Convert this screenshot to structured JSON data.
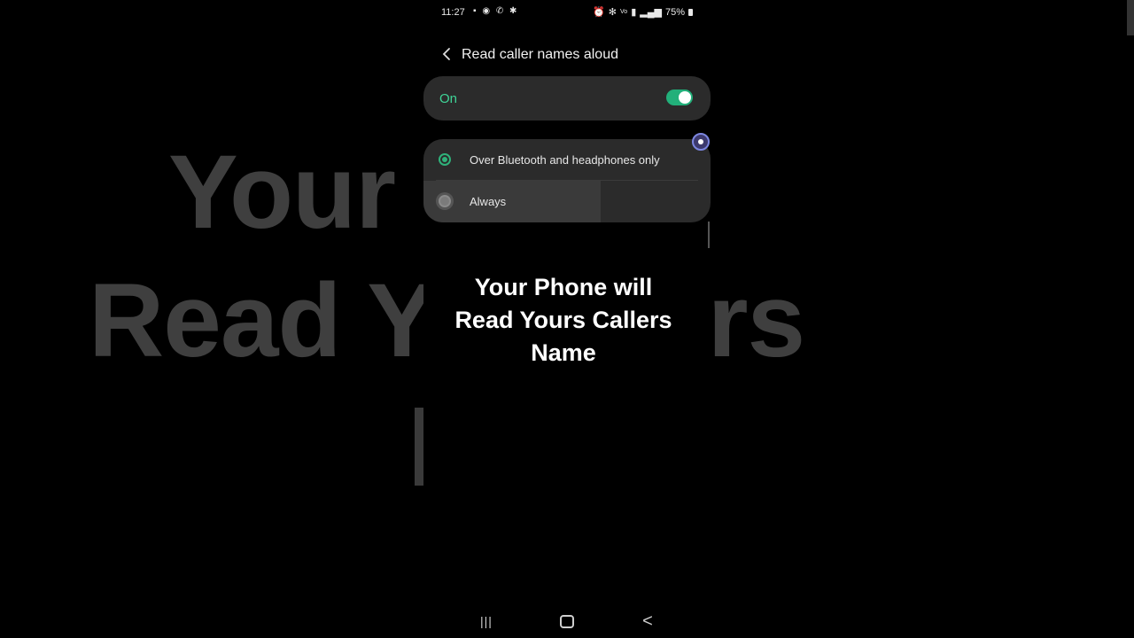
{
  "background": {
    "line1": "Your        e will",
    "line2": "Read Y        Callers"
  },
  "status_bar": {
    "time": "11:27",
    "left_icons": [
      "message-icon",
      "whatsapp-icon",
      "call-icon",
      "settings-icon"
    ],
    "battery": "75%"
  },
  "header": {
    "title": "Read caller names aloud"
  },
  "main_toggle": {
    "label": "On",
    "state": true,
    "accent": "#3fd497"
  },
  "options": [
    {
      "label": "Over Bluetooth and headphones only",
      "selected": true
    },
    {
      "label": "Always",
      "selected": false
    }
  ],
  "caption": {
    "line1": "Your Phone will",
    "line2": "Read Yours Callers",
    "line3": "Name"
  },
  "nav": {
    "recents": "|||",
    "back": "<"
  },
  "colors": {
    "card": "#2b2b2b",
    "accent_green": "#2fb27a"
  }
}
